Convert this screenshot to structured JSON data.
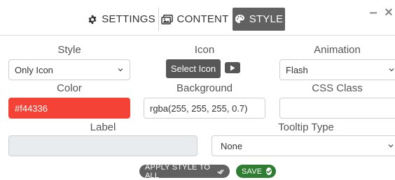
{
  "tabs": {
    "settings": "SETTINGS",
    "content": "CONTENT",
    "style": "STYLE"
  },
  "window": {
    "minimize": "–",
    "close": "×"
  },
  "fields": {
    "style": {
      "label": "Style",
      "value": "Only Icon"
    },
    "icon": {
      "label": "Icon",
      "button": "Select Icon"
    },
    "animation": {
      "label": "Animation",
      "value": "Flash"
    },
    "color": {
      "label": "Color",
      "value": "#f44336"
    },
    "background": {
      "label": "Background",
      "value": "rgba(255, 255, 255, 0.7)"
    },
    "css_class": {
      "label": "CSS Class",
      "value": ""
    },
    "label": {
      "label": "Label",
      "value": ""
    },
    "tooltip_type": {
      "label": "Tooltip Type",
      "value": "None"
    }
  },
  "actions": {
    "apply_all": "APPLY STYLE TO ALL",
    "save": "SAVE"
  },
  "colors": {
    "active_tab": "#616161",
    "color_swatch": "#f44336",
    "save": "#2e7d32"
  }
}
